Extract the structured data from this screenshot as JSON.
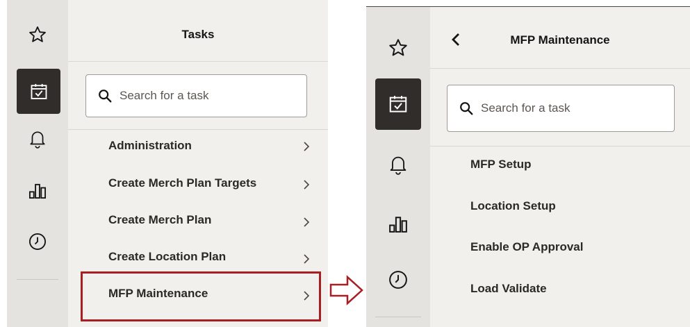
{
  "left_panel": {
    "header_title": "Tasks",
    "search": {
      "placeholder": "Search for a task"
    },
    "items": [
      {
        "label": "Administration"
      },
      {
        "label": "Create Merch Plan Targets"
      },
      {
        "label": "Create Merch Plan"
      },
      {
        "label": "Create Location Plan"
      },
      {
        "label": "MFP Maintenance",
        "highlighted": true
      }
    ]
  },
  "right_panel": {
    "header_title": "MFP Maintenance",
    "search": {
      "placeholder": "Search for a task"
    },
    "items": [
      {
        "label": "MFP Setup"
      },
      {
        "label": "Location Setup"
      },
      {
        "label": "Enable OP Approval"
      },
      {
        "label": "Load Validate"
      }
    ]
  },
  "rail_icons": [
    "star-icon",
    "calendar-check-icon",
    "bell-icon",
    "bar-chart-icon",
    "clock-icon"
  ],
  "colors": {
    "highlight": "#a81e22",
    "rail_active": "#312d2a",
    "rail_bg": "#e4e3e0",
    "content_bg": "#f1f0ed"
  }
}
